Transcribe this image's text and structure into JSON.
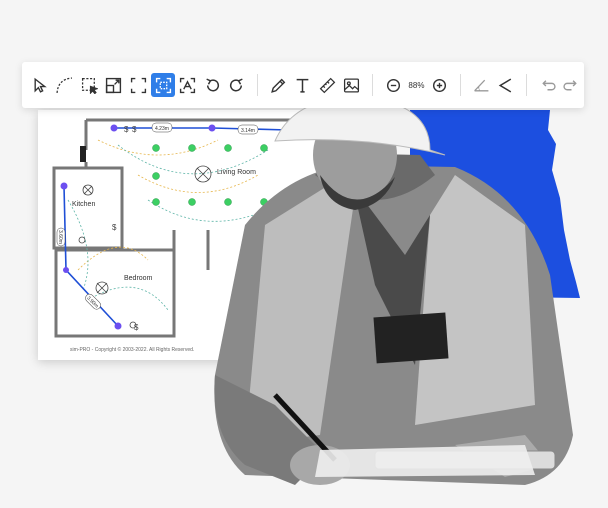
{
  "toolbar": {
    "tools": [
      {
        "name": "select-pointer-icon",
        "active": false
      },
      {
        "name": "arc-curve-icon",
        "active": false
      },
      {
        "name": "select-area-icon",
        "active": false
      },
      {
        "name": "resize-icon",
        "active": false
      },
      {
        "name": "crop-frame-icon",
        "active": false
      },
      {
        "name": "focus-frame-icon",
        "active": true
      },
      {
        "name": "detect-icon",
        "active": false
      },
      {
        "name": "rotate-left-icon",
        "active": false
      },
      {
        "name": "rotate-right-icon",
        "active": false
      },
      {
        "name": "pencil-icon",
        "active": false
      },
      {
        "name": "text-icon",
        "active": false
      },
      {
        "name": "ruler-icon",
        "active": false
      },
      {
        "name": "image-icon",
        "active": false
      },
      {
        "name": "zoom-out-icon",
        "active": false
      },
      {
        "name": "zoom-in-icon",
        "active": false
      },
      {
        "name": "angle-icon",
        "active": false
      },
      {
        "name": "share-icon",
        "active": false
      },
      {
        "name": "undo-icon",
        "active": false
      },
      {
        "name": "redo-icon",
        "active": false
      }
    ],
    "zoom_label": "88%",
    "accent_color": "#2f7ee8"
  },
  "blueprint": {
    "rooms": {
      "living_room": "Living Room",
      "kitchen": "Kitchen",
      "bedroom": "Bedroom"
    },
    "measurements": [
      "4.23m",
      "3.14m",
      "3.60m",
      "3.90m"
    ],
    "copyright": "sim-PRO - Copyright © 2003-2022. All Rights Reserved.",
    "wire_color": "#1f4fd6",
    "node_color": "#6c4ff0",
    "light_color": "#3ccf63"
  },
  "decor": {
    "splash_color": "#1c4fe0"
  }
}
